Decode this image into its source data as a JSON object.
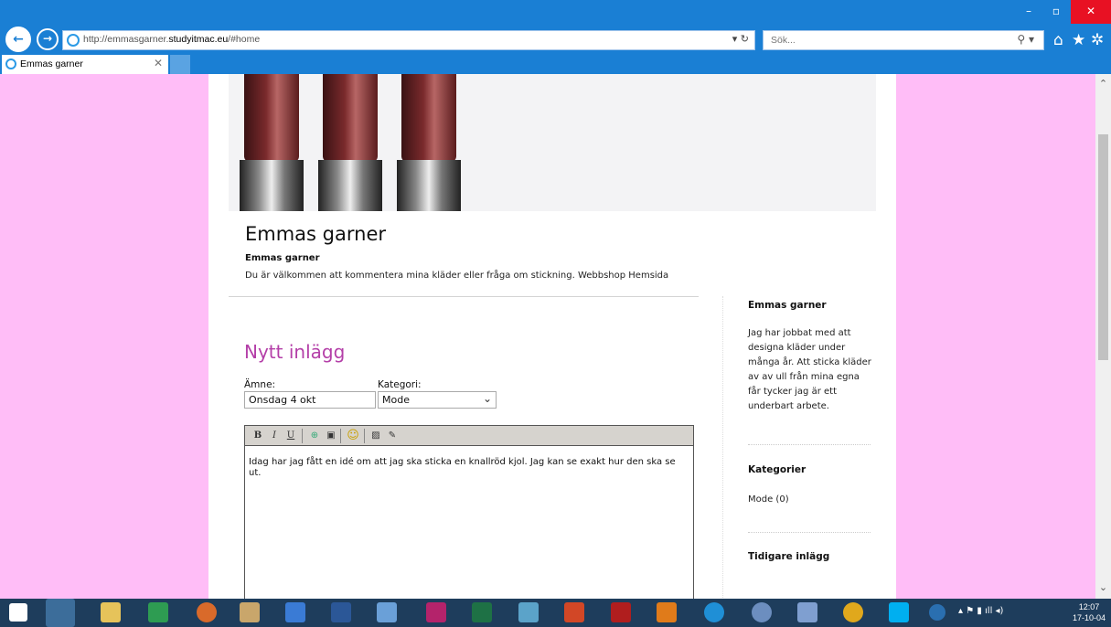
{
  "browser": {
    "url_prefix": "http://emmasgarner.",
    "url_domain": "studyitmac.eu",
    "url_suffix": "/#home",
    "search_placeholder": "Sök...",
    "tab_title": "Emmas garner"
  },
  "site": {
    "title": "Emmas garner",
    "subtitle": "Emmas garner",
    "description": "Du är välkommen att kommentera mina kläder eller fråga om stickning. Webbshop Hemsida"
  },
  "form": {
    "heading": "Nytt inlägg",
    "subject_label": "Ämne:",
    "subject_value": "Onsdag 4 okt",
    "category_label": "Kategori:",
    "category_value": "Mode",
    "toolbar": {
      "bold": "B",
      "italic": "I",
      "underline": "U"
    },
    "body_text": "Idag har jag fått en idé om att jag ska sticka en knallröd kjol. Jag kan se exakt hur den ska se ut."
  },
  "sidebar": {
    "about_heading": "Emmas garner",
    "about_text": "Jag har jobbat med att designa kläder under många år. Att sticka kläder av av ull från mina egna får tycker jag är ett underbart arbete.",
    "categories_heading": "Kategorier",
    "category_item": "Mode (0)",
    "archive_heading": "Tidigare inlägg"
  },
  "taskbar": {
    "time": "12:07",
    "date": "17-10-04"
  },
  "colors": {
    "page_bg": "#ffbdf7",
    "heading_accent": "#b43fa8",
    "chrome": "#1a7fd4"
  }
}
